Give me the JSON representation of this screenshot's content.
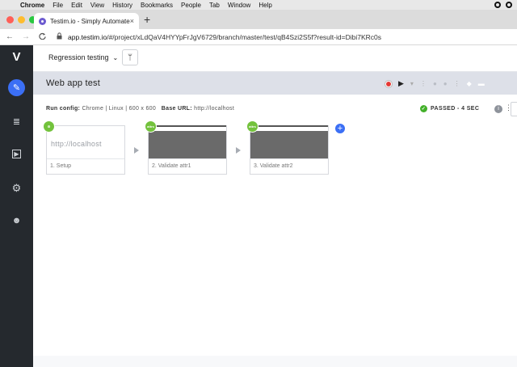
{
  "mac_menu": {
    "apple": "",
    "items": [
      "Chrome",
      "File",
      "Edit",
      "View",
      "History",
      "Bookmarks",
      "People",
      "Tab",
      "Window",
      "Help"
    ]
  },
  "browser": {
    "tab_title": "Testim.io - Simply Automate",
    "tab_close": "×",
    "new_tab": "+",
    "back": "←",
    "forward": "→",
    "reload": "C",
    "url_host": "app.testim.io",
    "url_rest": "/#/project/xLdQaV4HYYpFrJgV6729/branch/master/test/qB4Szi2S5f?result-id=Dibi7KRc0s"
  },
  "sidebar": {
    "logo": "V",
    "items": [
      {
        "icon": "pencil-icon",
        "glyph": "✎"
      },
      {
        "icon": "list-icon",
        "glyph": "≣"
      },
      {
        "icon": "play-square-icon",
        "glyph": "▶"
      },
      {
        "icon": "gear-icon",
        "glyph": "⚙"
      },
      {
        "icon": "users-icon",
        "glyph": "☻"
      }
    ]
  },
  "topbar": {
    "branch_label": "Regression testing",
    "chevron": "⌄",
    "branch_icon": "ᛘ"
  },
  "test": {
    "title": "Web app test",
    "play": "▶",
    "dropdown": "▾",
    "dots": "⋮"
  },
  "run": {
    "config_label": "Run config:",
    "config_value": "Chrome | Linux | 600 x 600",
    "base_label": "Base URL:",
    "base_value": "http://localhost",
    "status": "PASSED - 4 SEC",
    "check": "✓",
    "info": "i",
    "more": "⋮"
  },
  "steps": [
    {
      "preview": "http://localhost",
      "caption": "1. Setup"
    },
    {
      "badge": "attrs",
      "caption": "2. Validate attr1"
    },
    {
      "badge": "attrs",
      "caption": "3. Validate attr2"
    }
  ],
  "add_step": "+"
}
